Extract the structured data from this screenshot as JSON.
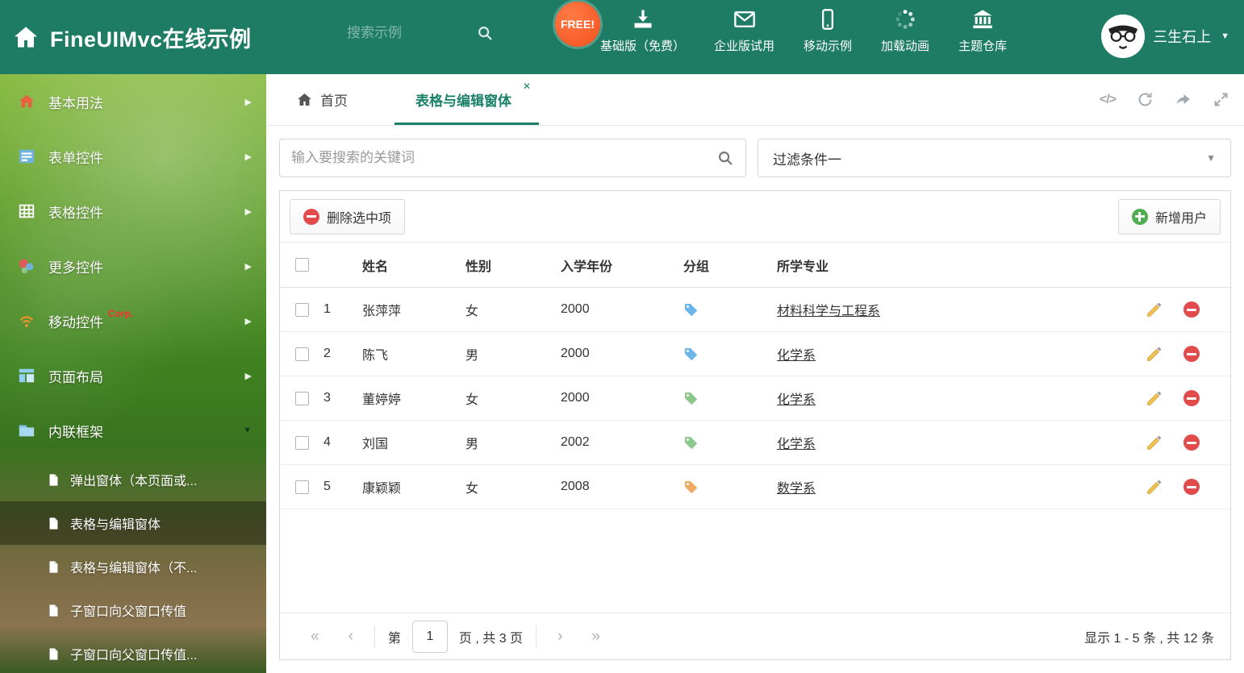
{
  "colors": {
    "header_bg": "#1d7c63",
    "accent": "#1a8168",
    "free_badge": "#f4511e",
    "delete_red": "#e14b4b",
    "add_green": "#4fae51"
  },
  "header": {
    "title": "FineUIMvc在线示例",
    "search_placeholder": "搜索示例",
    "free_badge": "FREE!",
    "nav": [
      {
        "label": "基础版（免费）"
      },
      {
        "label": "企业版试用"
      },
      {
        "label": "移动示例"
      },
      {
        "label": "加载动画"
      },
      {
        "label": "主题仓库"
      }
    ],
    "username": "三生石上"
  },
  "sidebar": {
    "items": [
      {
        "label": "基本用法"
      },
      {
        "label": "表单控件"
      },
      {
        "label": "表格控件"
      },
      {
        "label": "更多控件"
      },
      {
        "label": "移动控件",
        "badge": "Corp."
      },
      {
        "label": "页面布局"
      },
      {
        "label": "内联框架"
      }
    ],
    "subitems": [
      {
        "label": "弹出窗体（本页面或..."
      },
      {
        "label": "表格与编辑窗体"
      },
      {
        "label": "表格与编辑窗体（不..."
      },
      {
        "label": "子窗口向父窗口传值"
      },
      {
        "label": "子窗口向父窗口传值..."
      }
    ]
  },
  "tabs": {
    "home": "首页",
    "active": "表格与编辑窗体"
  },
  "filter": {
    "search_placeholder": "输入要搜索的关键词",
    "dropdown_value": "过滤条件一"
  },
  "toolbar": {
    "delete_label": "删除选中项",
    "add_label": "新增用户"
  },
  "table": {
    "headers": [
      "姓名",
      "性别",
      "入学年份",
      "分组",
      "所学专业"
    ],
    "rows": [
      {
        "num": "1",
        "name": "张萍萍",
        "gender": "女",
        "year": "2000",
        "tag_color": "#6db5e8",
        "major": "材料科学与工程系"
      },
      {
        "num": "2",
        "name": "陈飞",
        "gender": "男",
        "year": "2000",
        "tag_color": "#6db5e8",
        "major": "化学系"
      },
      {
        "num": "3",
        "name": "董婷婷",
        "gender": "女",
        "year": "2000",
        "tag_color": "#8cc88c",
        "major": "化学系"
      },
      {
        "num": "4",
        "name": "刘国",
        "gender": "男",
        "year": "2002",
        "tag_color": "#8cc88c",
        "major": "化学系"
      },
      {
        "num": "5",
        "name": "康颖颖",
        "gender": "女",
        "year": "2008",
        "tag_color": "#f0aa64",
        "major": "数学系"
      }
    ]
  },
  "pagination": {
    "label_before": "第",
    "current": "1",
    "label_after": "页 , 共 3 页",
    "summary": "显示 1 - 5 条 , 共 12 条"
  },
  "icons": {
    "arrow_right": "▶",
    "arrow_down": "▼",
    "caret_down": "▼",
    "close": "✕",
    "code": "</>",
    "first": "«",
    "prev": "‹",
    "next": "›",
    "last": "»"
  }
}
